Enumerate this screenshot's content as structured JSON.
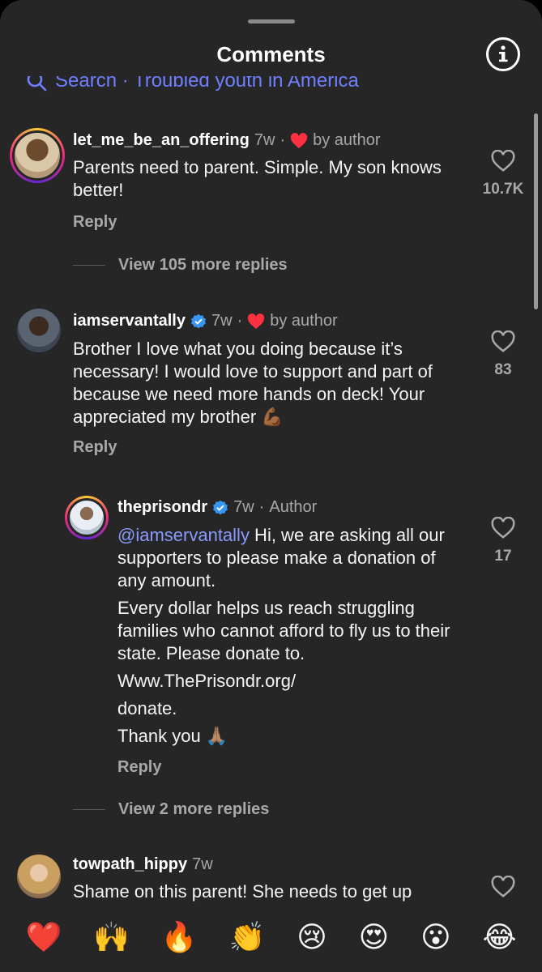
{
  "header": {
    "title": "Comments"
  },
  "search": {
    "text": "Search · Troubled youth in America"
  },
  "comments": [
    {
      "username": "let_me_be_an_offering",
      "time": "7w",
      "sep": "·",
      "liked_by": "by author",
      "text": "Parents need to parent. Simple. My son knows better!",
      "likes": "10.7K",
      "reply_label": "Reply",
      "view_replies": "View 105 more replies"
    },
    {
      "username": "iamservantally",
      "time": "7w",
      "sep": "·",
      "liked_by": "by author",
      "text": "Brother I love what you doing because it’s necessary! I would love to support and part of because we need more hands on deck! Your appreciated my brother 💪🏾",
      "likes": "83",
      "reply_label": "Reply",
      "reply": {
        "username": "theprisondr",
        "time": "7w",
        "sep": "·",
        "badge": "Author",
        "mention": "@iamservantally",
        "line1": " Hi, we are asking all our supporters to please make a donation of any amount.",
        "line2": "Every dollar helps us reach struggling families who cannot afford to fly us to their state. Please donate to.",
        "line3": "Www.ThePrisondr.org/",
        "line4": "donate.",
        "line5": "Thank you 🙏🏽",
        "likes": "17",
        "reply_label": "Reply"
      },
      "view_replies": "View 2 more replies"
    },
    {
      "username": "towpath_hippy",
      "time": "7w",
      "text": "Shame on this parent! She needs to get up"
    }
  ],
  "emoji_bar": [
    "❤️",
    "🙌",
    "🔥",
    "👏",
    "😢",
    "😍",
    "😮",
    "😂"
  ],
  "colors": {
    "sheet_bg": "#262626",
    "mention": "#8a9bff",
    "search": "#6f7fff",
    "heart": "#ff3040"
  }
}
